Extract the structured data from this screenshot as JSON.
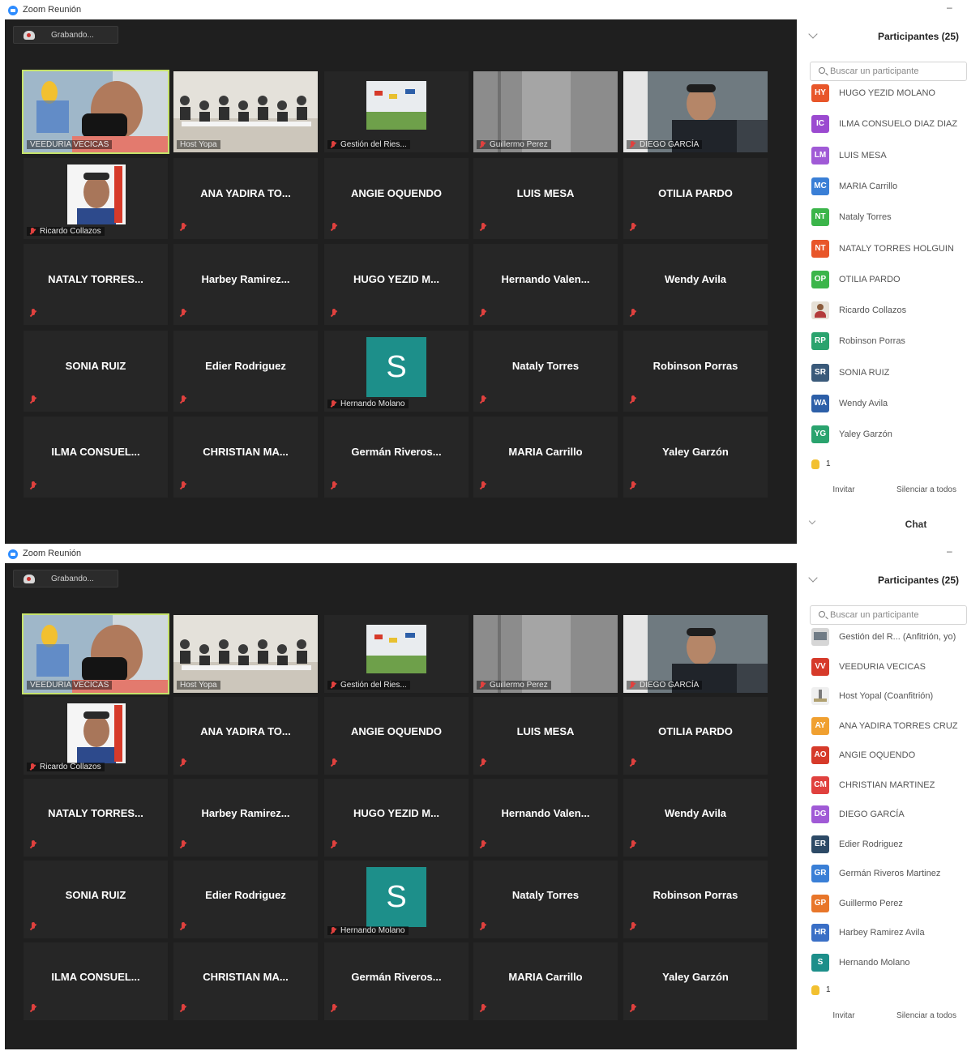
{
  "colors": {
    "zoom_blue": "#2D8CFF",
    "video_bg": "#1f1f1f",
    "tile_bg": "#262626",
    "active_speaker": "#c6e36b",
    "muted_red": "#e0413e"
  },
  "screens": [
    {
      "window_title": "Zoom Reunión",
      "recording_label": "Grabando...",
      "participants_header": "Participantes (25)",
      "search_placeholder": "Buscar un participante",
      "hand_count": "1",
      "invite_label": "Invitar",
      "mute_all_label": "Silenciar a todos",
      "chat_label": "Chat",
      "video_tiles": [
        {
          "kind": "video",
          "label": "VEEDURIA VECICAS",
          "active": true,
          "muted": false,
          "scene": "hand"
        },
        {
          "kind": "video",
          "label": "Host Yopa",
          "active": false,
          "muted": false,
          "scene": "room"
        },
        {
          "kind": "video",
          "label": "Gestión del Ries...",
          "active": false,
          "muted": true,
          "scene": "poster"
        },
        {
          "kind": "video",
          "label": "Guillermo Perez",
          "active": false,
          "muted": true,
          "scene": "wall"
        },
        {
          "kind": "video",
          "label": "DIEGO GARCÍA",
          "active": false,
          "muted": true,
          "scene": "man"
        },
        {
          "kind": "video",
          "label": "Ricardo Collazos",
          "active": false,
          "muted": true,
          "scene": "portrait"
        },
        {
          "kind": "name",
          "label": "ANA YADIRA TO..."
        },
        {
          "kind": "name",
          "label": "ANGIE OQUENDO"
        },
        {
          "kind": "name",
          "label": "LUIS MESA"
        },
        {
          "kind": "name",
          "label": "OTILIA PARDO"
        },
        {
          "kind": "name",
          "label": "NATALY TORRES..."
        },
        {
          "kind": "name",
          "label": "Harbey Ramirez..."
        },
        {
          "kind": "name",
          "label": "HUGO YEZID M..."
        },
        {
          "kind": "name",
          "label": "Hernando Valen..."
        },
        {
          "kind": "name",
          "label": "Wendy Avila"
        },
        {
          "kind": "name",
          "label": "SONIA RUIZ"
        },
        {
          "kind": "name",
          "label": "Edier Rodriguez"
        },
        {
          "kind": "avatar",
          "label": "Hernando Molano",
          "letter": "S"
        },
        {
          "kind": "name",
          "label": "Nataly Torres"
        },
        {
          "kind": "name",
          "label": "Robinson Porras"
        },
        {
          "kind": "name",
          "label": "ILMA CONSUEL..."
        },
        {
          "kind": "name",
          "label": "CHRISTIAN MA..."
        },
        {
          "kind": "name",
          "label": "Germán Riveros..."
        },
        {
          "kind": "name",
          "label": "MARIA Carrillo"
        },
        {
          "kind": "name",
          "label": "Yaley Garzón"
        }
      ],
      "participants": [
        {
          "initials": "HY",
          "name": "HUGO YEZID MOLANO",
          "color": "#e8562a"
        },
        {
          "initials": "IC",
          "name": "ILMA CONSUELO DIAZ DIAZ",
          "color": "#9b4ad0"
        },
        {
          "initials": "LM",
          "name": "LUIS MESA",
          "color": "#a05ad6"
        },
        {
          "initials": "MC",
          "name": "MARIA Carrillo",
          "color": "#3a7fd6"
        },
        {
          "initials": "NT",
          "name": "Nataly Torres",
          "color": "#3bb54a"
        },
        {
          "initials": "NT",
          "name": "NATALY TORRES HOLGUIN",
          "color": "#e8562a"
        },
        {
          "initials": "OP",
          "name": "OTILIA PARDO",
          "color": "#3bb54a"
        },
        {
          "initials": "",
          "name": "Ricardo Collazos",
          "color": "#e6e0d6",
          "photo": "photo"
        },
        {
          "initials": "RP",
          "name": "Robinson Porras",
          "color": "#2aa36e"
        },
        {
          "initials": "SR",
          "name": "SONIA RUIZ",
          "color": "#3a5a7a"
        },
        {
          "initials": "WA",
          "name": "Wendy Avila",
          "color": "#2d5fa8"
        },
        {
          "initials": "YG",
          "name": "Yaley Garzón",
          "color": "#2aa36e"
        }
      ]
    },
    {
      "window_title": "Zoom Reunión",
      "recording_label": "Grabando...",
      "participants_header": "Participantes (25)",
      "search_placeholder": "Buscar un participante",
      "hand_count": "1",
      "invite_label": "Invitar",
      "mute_all_label": "Silenciar a todos",
      "video_tiles": [
        {
          "kind": "video",
          "label": "VEEDURIA VECICAS",
          "active": true,
          "muted": false,
          "scene": "hand"
        },
        {
          "kind": "video",
          "label": "Host Yopa",
          "active": false,
          "muted": false,
          "scene": "room"
        },
        {
          "kind": "video",
          "label": "Gestión del Ries...",
          "active": false,
          "muted": true,
          "scene": "poster"
        },
        {
          "kind": "video",
          "label": "Guillermo Perez",
          "active": false,
          "muted": true,
          "scene": "wall"
        },
        {
          "kind": "video",
          "label": "DIEGO GARCÍA",
          "active": false,
          "muted": true,
          "scene": "man"
        },
        {
          "kind": "video",
          "label": "Ricardo Collazos",
          "active": false,
          "muted": true,
          "scene": "portrait"
        },
        {
          "kind": "name",
          "label": "ANA YADIRA TO..."
        },
        {
          "kind": "name",
          "label": "ANGIE OQUENDO"
        },
        {
          "kind": "name",
          "label": "LUIS MESA"
        },
        {
          "kind": "name",
          "label": "OTILIA PARDO"
        },
        {
          "kind": "name",
          "label": "NATALY TORRES..."
        },
        {
          "kind": "name",
          "label": "Harbey Ramirez..."
        },
        {
          "kind": "name",
          "label": "HUGO YEZID M..."
        },
        {
          "kind": "name",
          "label": "Hernando Valen..."
        },
        {
          "kind": "name",
          "label": "Wendy Avila"
        },
        {
          "kind": "name",
          "label": "SONIA RUIZ"
        },
        {
          "kind": "name",
          "label": "Edier Rodriguez"
        },
        {
          "kind": "avatar",
          "label": "Hernando Molano",
          "letter": "S"
        },
        {
          "kind": "name",
          "label": "Nataly Torres"
        },
        {
          "kind": "name",
          "label": "Robinson Porras"
        },
        {
          "kind": "name",
          "label": "ILMA CONSUEL..."
        },
        {
          "kind": "name",
          "label": "CHRISTIAN MA..."
        },
        {
          "kind": "name",
          "label": "Germán Riveros..."
        },
        {
          "kind": "name",
          "label": "MARIA Carrillo"
        },
        {
          "kind": "name",
          "label": "Yaley Garzón"
        }
      ],
      "participants": [
        {
          "initials": "",
          "name": "Gestión del R...  (Anfitrión, yo)",
          "color": "#d6d6d6",
          "photo": "photo3"
        },
        {
          "initials": "VV",
          "name": "VEEDURIA VECICAS",
          "color": "#d63a2a"
        },
        {
          "initials": "",
          "name": "Host Yopal (Coanfitrión)",
          "color": "#efefef",
          "photo": "photo2"
        },
        {
          "initials": "AY",
          "name": "ANA YADIRA TORRES CRUZ",
          "color": "#f0a030"
        },
        {
          "initials": "AO",
          "name": "ANGIE OQUENDO",
          "color": "#d63a2a"
        },
        {
          "initials": "CM",
          "name": "CHRISTIAN MARTINEZ",
          "color": "#e0413e"
        },
        {
          "initials": "DG",
          "name": "DIEGO GARCÍA",
          "color": "#a05ad6"
        },
        {
          "initials": "ER",
          "name": "Edier Rodriguez",
          "color": "#2d4a66"
        },
        {
          "initials": "GR",
          "name": "Germán Riveros Martinez",
          "color": "#3a7fd6"
        },
        {
          "initials": "GP",
          "name": "Guillermo Perez",
          "color": "#e8762a"
        },
        {
          "initials": "HR",
          "name": "Harbey Ramirez Avila",
          "color": "#3a6fc6"
        },
        {
          "initials": "S",
          "name": "Hernando Molano",
          "color": "#1d8f8a"
        }
      ]
    }
  ]
}
